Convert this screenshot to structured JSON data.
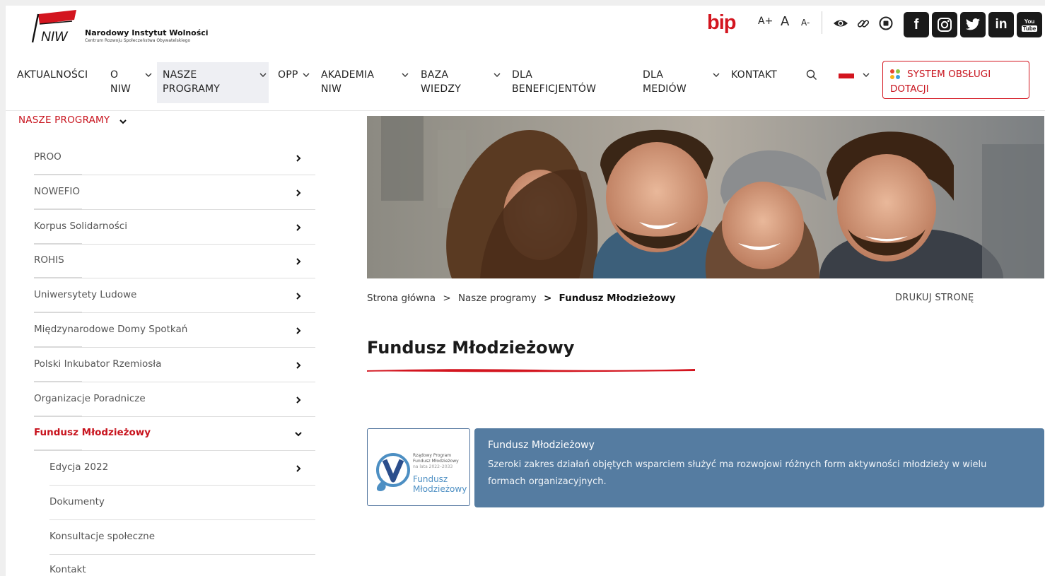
{
  "brand": {
    "logo_text": "NIW",
    "name": "Narodowy Instytut Wolności",
    "subtitle": "Centrum Rozwoju Społeczeństwa Obywatelskiego"
  },
  "topbar": {
    "bip": "bip",
    "font_increase": "A+",
    "font_normal": "A",
    "font_decrease": "A-",
    "icons": [
      "eye-icon",
      "link-icon",
      "contrast-icon"
    ],
    "social": [
      "facebook-icon",
      "instagram-icon",
      "twitter-icon",
      "linkedin-icon",
      "youtube-icon"
    ]
  },
  "nav": {
    "items": [
      {
        "label": "AKTUALNOŚCI"
      },
      {
        "label_1": "O",
        "label_2": "NIW"
      },
      {
        "label_1": "NASZE",
        "label_2": "PROGRAMY"
      },
      {
        "label": "OPP"
      },
      {
        "label_1": "AKADEMIA",
        "label_2": "NIW"
      },
      {
        "label_1": "BAZA",
        "label_2": "WIEDZY"
      },
      {
        "label_1": "DLA",
        "label_2": "BENEFICJENTÓW"
      },
      {
        "label_1": "DLA",
        "label_2": "MEDIÓW"
      },
      {
        "label": "KONTAKT"
      }
    ],
    "cta": "SYSTEM OBSŁUGI DOTACJI"
  },
  "sidebar": {
    "heading": "NASZE PROGRAMY",
    "items": [
      {
        "label": "PROO"
      },
      {
        "label": "NOWEFIO"
      },
      {
        "label": "Korpus Solidarności"
      },
      {
        "label": "ROHIS"
      },
      {
        "label": "Uniwersytety Ludowe"
      },
      {
        "label": "Międzynarodowe Domy Spotkań"
      },
      {
        "label": "Polski Inkubator Rzemiosła"
      },
      {
        "label": "Organizacje Poradnicze"
      },
      {
        "label": "Fundusz Młodzieżowy"
      },
      {
        "label": "Edycja 2022"
      },
      {
        "label": "Dokumenty"
      },
      {
        "label": "Konsultacje społeczne"
      },
      {
        "label": "Kontakt"
      }
    ]
  },
  "breadcrumb": {
    "home": "Strona główna",
    "sep": ">",
    "parent": "Nasze programy",
    "current": "Fundusz Młodzieżowy"
  },
  "print_label": "DRUKUJ STRONĘ",
  "page_title": "Fundusz Młodzieżowy",
  "card": {
    "logo_small_1": "Rządowy Program",
    "logo_small_2": "Fundusz Młodzieżowy",
    "logo_small_3": "na lata 2022–2033",
    "logo_big_1": "Fundusz",
    "logo_big_2": "Młodzieżowy",
    "title": "Fundusz Młodzieżowy",
    "description": "Szeroki zakres działań objętych wsparciem służyć ma rozwojowi różnych form aktywności młodzieży w wielu formach organizacyjnych."
  },
  "colors": {
    "accent": "#c8141e",
    "card_bg": "#557ca1"
  }
}
